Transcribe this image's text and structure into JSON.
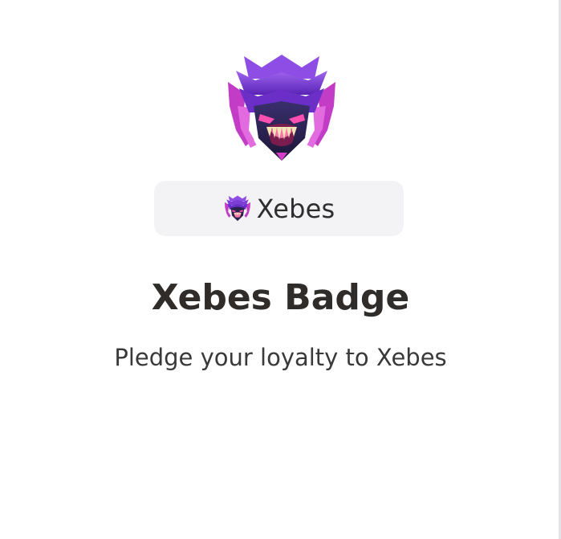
{
  "badge": {
    "name": "Xebes",
    "title": "Xebes Badge",
    "description": "Pledge your loyalty to Xebes",
    "emblem_icon": "xebes-monster-emblem-icon",
    "colors": {
      "emblem_purple": "#7b3fd8",
      "emblem_magenta": "#d63dc9",
      "pill_background": "#f3f3f5",
      "title_text": "#2f2c2a"
    }
  }
}
